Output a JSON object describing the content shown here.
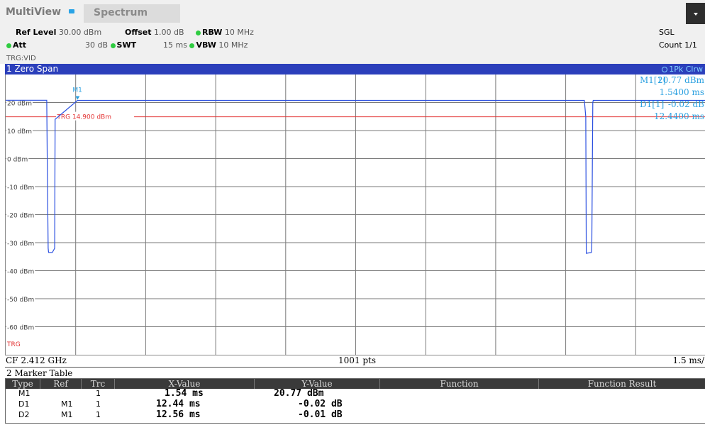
{
  "top_bar": {
    "app_title": "MultiView",
    "tab_label": "Spectrum"
  },
  "settings": {
    "ref_level_label": "Ref Level",
    "ref_level_value": "30.00 dBm",
    "offset_label": "Offset",
    "offset_value": "1.00 dB",
    "rbw_label": "RBW",
    "rbw_value": "10 MHz",
    "att_label": "Att",
    "att_value": "30 dB",
    "swt_label": "SWT",
    "swt_value": "15 ms",
    "vbw_label": "VBW",
    "vbw_value": "10 MHz",
    "sweep_mode": "SGL",
    "count": "Count 1/1",
    "trigger_source": "TRG:VID"
  },
  "window": {
    "title": "1 Zero Span",
    "trace_label": "1Pk Clrw"
  },
  "plot": {
    "y_labels": [
      "20 dBm",
      "10 dBm",
      "0 dBm",
      "-10 dBm",
      "-20 dBm",
      "-30 dBm",
      "-40 dBm",
      "-50 dBm",
      "-60 dBm"
    ],
    "trigger_label": "TRG 14.900 dBm",
    "trigger_bottom_label": "TRG",
    "marker_label": "M1",
    "marker_info": [
      {
        "name": "M1[1]",
        "value": "20.77 dBm",
        "time": "1.5400 ms"
      },
      {
        "name": "D1[1]",
        "value": "-0.02 dB",
        "time": "12.4400 ms"
      }
    ],
    "colors": {
      "trace": "#2a4fe0",
      "trigger": "#e33333",
      "marker": "#2aa0e0",
      "grid": "#7a7a7a"
    }
  },
  "chart_data": {
    "type": "line",
    "title": "",
    "xlabel": "",
    "ylabel": "",
    "xlim": [
      0,
      15
    ],
    "ylim": [
      -70,
      30
    ],
    "y_ticks": [
      20,
      10,
      0,
      -10,
      -20,
      -30,
      -40,
      -50,
      -60
    ],
    "series": [
      {
        "x": [
          0.0,
          0.88,
          0.89,
          0.91,
          0.92,
          1.0,
          1.05,
          1.06,
          1.54,
          3.0,
          6.0,
          9.0,
          12.4,
          12.43,
          12.44,
          12.55,
          12.56,
          12.58,
          12.59,
          15.0
        ],
        "y": [
          20.8,
          20.8,
          0.0,
          -32.0,
          -33.5,
          -33.5,
          -32.0,
          14.0,
          20.77,
          20.75,
          20.75,
          20.75,
          20.75,
          14.9,
          -33.8,
          -33.5,
          -31.0,
          20.0,
          20.76,
          20.76
        ]
      }
    ],
    "trigger_level": 14.9
  },
  "footer": {
    "center_freq": "CF 2.412 GHz",
    "points": "1001 pts",
    "span": "1.5 ms/"
  },
  "marker_table": {
    "title": "2 Marker Table",
    "columns": [
      "Type",
      "Ref",
      "Trc",
      "X-Value",
      "Y-Value",
      "Function",
      "Function Result"
    ],
    "rows": [
      {
        "type": "M1",
        "ref": "",
        "trc": "1",
        "x": "1.54 ms",
        "y": "20.77 dBm"
      },
      {
        "type": "D1",
        "ref": "M1",
        "trc": "1",
        "x": "12.44 ms",
        "y": "-0.02 dB"
      },
      {
        "type": "D2",
        "ref": "M1",
        "trc": "1",
        "x": "12.56 ms",
        "y": "-0.01 dB"
      }
    ]
  }
}
